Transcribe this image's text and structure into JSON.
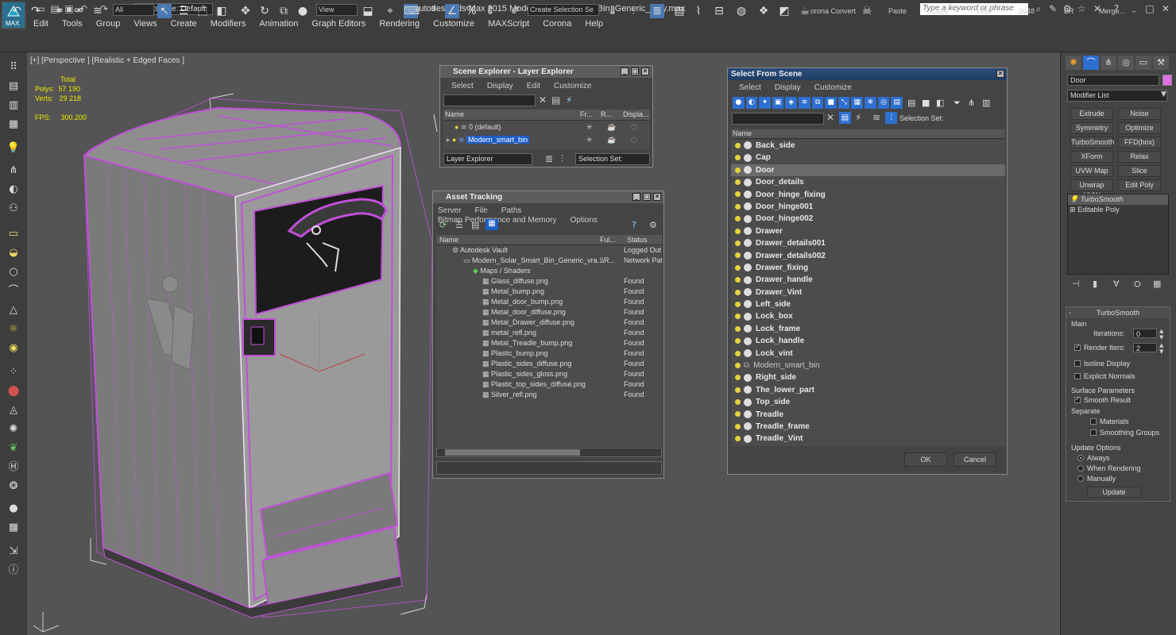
{
  "title_bar": {
    "logo_label": "MAX",
    "workspace": "Workspace: Default",
    "app_title": "Autodesk 3ds Max  2015     Modern_Solar_Smart_Bin_Generic_vray.max",
    "search_placeholder": "Type a keyword or phrase"
  },
  "menu": [
    "Edit",
    "Tools",
    "Group",
    "Views",
    "Create",
    "Modifiers",
    "Animation",
    "Graph Editors",
    "Rendering",
    "Customize",
    "MAXScript",
    "Corona",
    "Help"
  ],
  "toolbar": {
    "filter_value": "All",
    "view_value": "View",
    "selection_set_placeholder": "Create Selection Se",
    "corona_convert": "orona Convert",
    "paste": "Paste",
    "copy": "Copy",
    "w1480": "1480",
    "w2048": "2048",
    "br": "BR",
    "merge": "Merge..."
  },
  "viewport": {
    "label": "[+] [Perspective ] [Realistic + Edged Faces ]",
    "stats": {
      "total_label": "Total",
      "polys_label": "Polys:",
      "polys_value": "57 190",
      "verts_label": "Verts:",
      "verts_value": "29 218",
      "fps_label": "FPS:",
      "fps_value": "300.200"
    }
  },
  "scene_explorer": {
    "title": "Scene Explorer - Layer Explorer",
    "menu": [
      "Select",
      "Display",
      "Edit",
      "Customize"
    ],
    "columns": [
      "Name",
      "Fr...",
      "R...",
      "Displa..."
    ],
    "rows": [
      "0 (default)",
      "Modern_smart_bin"
    ],
    "footer_mode": "Layer Explorer",
    "footer_selection": "Selection Set:"
  },
  "asset_tracking": {
    "title": "Asset Tracking",
    "menu": [
      "Server",
      "File",
      "Paths",
      "Bitmap Performance and Memory",
      "Options"
    ],
    "columns": [
      "Name",
      "Ful...",
      "Status"
    ],
    "rows": [
      {
        "name": "Autodesk Vault",
        "full": "",
        "status": "Logged Out."
      },
      {
        "name": "Modern_Solar_Smart_Bin_Generic_vra...",
        "full": "\\\\R...",
        "status": "Network Path"
      },
      {
        "name": "Maps / Shaders",
        "full": "",
        "status": ""
      },
      {
        "name": "Glass_diffuse.png",
        "full": "",
        "status": "Found"
      },
      {
        "name": "Metal_bump.png",
        "full": "",
        "status": "Found"
      },
      {
        "name": "Metal_door_bump.png",
        "full": "",
        "status": "Found"
      },
      {
        "name": "Metal_door_diffuse.png",
        "full": "",
        "status": "Found"
      },
      {
        "name": "Metal_Drawer_diffuse.png",
        "full": "",
        "status": "Found"
      },
      {
        "name": "metal_refl.png",
        "full": "",
        "status": "Found"
      },
      {
        "name": "Metal_Treadle_bump.png",
        "full": "",
        "status": "Found"
      },
      {
        "name": "Plastic_bump.png",
        "full": "",
        "status": "Found"
      },
      {
        "name": "Plastic_sides_diffuse.png",
        "full": "",
        "status": "Found"
      },
      {
        "name": "Plastic_sides_gloss.png",
        "full": "",
        "status": "Found"
      },
      {
        "name": "Plastic_top_sides_diffuse.png",
        "full": "",
        "status": "Found"
      },
      {
        "name": "Silver_refl.png",
        "full": "",
        "status": "Found"
      }
    ]
  },
  "select_from_scene": {
    "title": "Select From Scene",
    "menu": [
      "Select",
      "Display",
      "Customize"
    ],
    "selection_set": "Selection Set:",
    "column_name": "Name",
    "items": [
      "Back_side",
      "Cap",
      "Door",
      "Door_details",
      "Door_hinge_fixing",
      "Door_hinge001",
      "Door_hinge002",
      "Drawer",
      "Drawer_details001",
      "Drawer_details002",
      "Drawer_fixing",
      "Drawer_handle",
      "Drawer_Vint",
      "Left_side",
      "Lock_box",
      "Lock_frame",
      "Lock_handle",
      "Lock_vint",
      "Modern_smart_bin",
      "Right_side",
      "The_lower_part",
      "Top_side",
      "Treadle",
      "Treadle_frame",
      "Treadle_Vint"
    ],
    "ok": "OK",
    "cancel": "Cancel"
  },
  "command_panel": {
    "object_name": "Door",
    "modifier_list": "Modifier List",
    "modifier_buttons": [
      "Extrude",
      "Noise",
      "Symmetry",
      "Optimize",
      "TurboSmooth",
      "FFD(box)",
      "XForm",
      "Relax",
      "UVW Map",
      "Slice",
      "Unwrap UVW",
      "Edit Poly"
    ],
    "stack": [
      "TurboSmooth",
      "Editable Poly"
    ],
    "rollout_title": "TurboSmooth",
    "main_label": "Main",
    "iterations_label": "Iterations:",
    "iterations_value": "0",
    "render_iters_label": "Render Iters:",
    "render_iters_value": "2",
    "isoline": "Isoline Display",
    "explicit_normals": "Explicit Normals",
    "surface_params": "Surface Parameters",
    "smooth_result": "Smooth Result",
    "separate": "Separate",
    "materials": "Materials",
    "smoothing_groups": "Smoothing Groups",
    "update_options": "Update Options",
    "always": "Always",
    "when_rendering": "When Rendering",
    "manually": "Manually",
    "update_btn": "Update"
  },
  "colors": {
    "wireframe": "#c050d8",
    "selection_highlight": "#1f5fc7",
    "stats_text": "#e8e800"
  }
}
